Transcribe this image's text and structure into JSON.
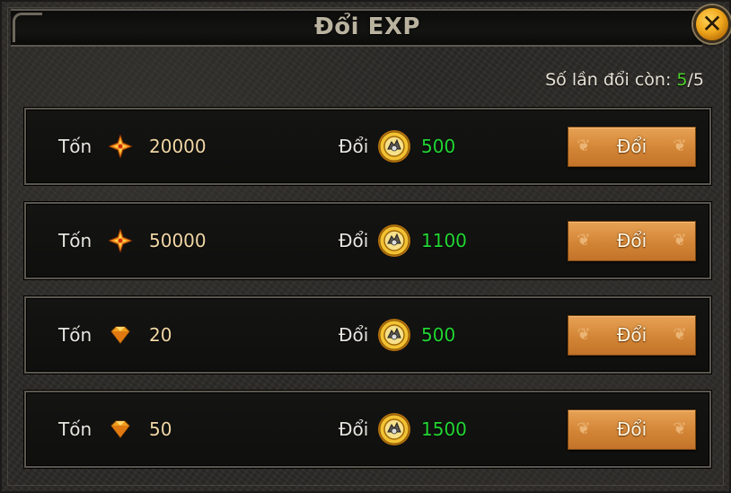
{
  "dialog": {
    "title": "Đổi EXP",
    "close_icon": "close-icon",
    "counter": {
      "prefix": "Số lần đổi còn: ",
      "remaining": "5",
      "separator": "/",
      "total": "5",
      "highlight_color": "#4ed12a"
    }
  },
  "rows": [
    {
      "cost_label": "Tốn",
      "cost_icon": "star-icon",
      "cost_value": "20000",
      "exchange_label": "Đổi",
      "reward_icon": "exp-coin-icon",
      "reward_value": "500",
      "button_label": "Đổi"
    },
    {
      "cost_label": "Tốn",
      "cost_icon": "star-icon",
      "cost_value": "50000",
      "exchange_label": "Đổi",
      "reward_icon": "exp-coin-icon",
      "reward_value": "1100",
      "button_label": "Đổi"
    },
    {
      "cost_label": "Tốn",
      "cost_icon": "diamond-icon",
      "cost_value": "20",
      "exchange_label": "Đổi",
      "reward_icon": "exp-coin-icon",
      "reward_value": "500",
      "button_label": "Đổi"
    },
    {
      "cost_label": "Tốn",
      "cost_icon": "diamond-icon",
      "cost_value": "50",
      "exchange_label": "Đổi",
      "reward_icon": "exp-coin-icon",
      "reward_value": "1500",
      "button_label": "Đổi"
    }
  ],
  "colors": {
    "reward": "#22d633",
    "cost": "#f2d7a6",
    "button": "#d38536"
  }
}
